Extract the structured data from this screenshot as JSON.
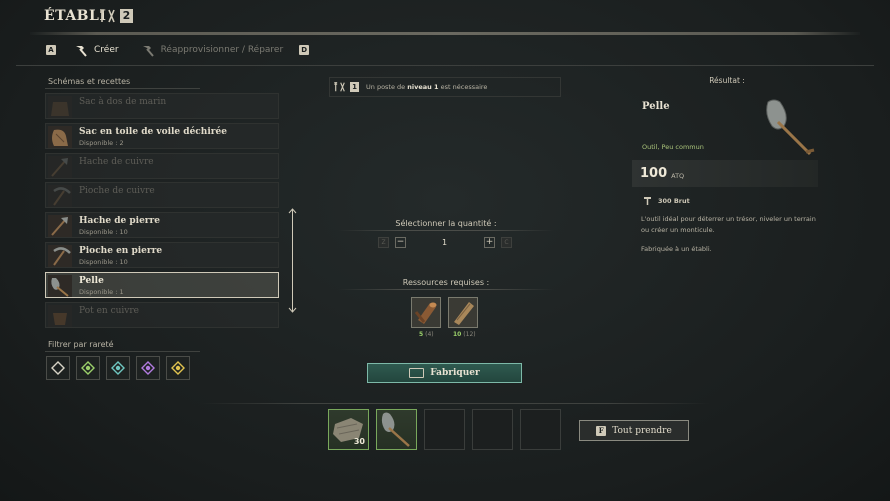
{
  "header": {
    "title": "ÉTABLI",
    "level": "2"
  },
  "tabs": {
    "left_key": "A",
    "right_key": "D",
    "items": [
      {
        "label": "Créer",
        "icon": "hammer-icon"
      },
      {
        "label": "Réapprovisionner / Réparer",
        "icon": "repair-hammer-icon"
      }
    ]
  },
  "recipes": {
    "title": "Schémas et recettes",
    "items": [
      {
        "name": "Sac à dos de marin",
        "available": "",
        "state": "disabled",
        "icon": "backpack-icon"
      },
      {
        "name": "Sac en toile de voile déchirée",
        "available": "Disponible : 2",
        "state": "enabled",
        "icon": "cloth-bag-icon"
      },
      {
        "name": "Hache de cuivre",
        "available": "",
        "state": "disabled",
        "icon": "axe-icon"
      },
      {
        "name": "Pioche de cuivre",
        "available": "",
        "state": "disabled",
        "icon": "pickaxe-icon"
      },
      {
        "name": "Hache de pierre",
        "available": "Disponible : 10",
        "state": "enabled",
        "icon": "axe-icon"
      },
      {
        "name": "Pioche en pierre",
        "available": "Disponible : 10",
        "state": "enabled",
        "icon": "pickaxe-icon"
      },
      {
        "name": "Pelle",
        "available": "Disponible : 1",
        "state": "selected",
        "icon": "shovel-icon"
      },
      {
        "name": "Pot en cuivre",
        "available": "",
        "state": "disabled",
        "icon": "pot-icon"
      }
    ]
  },
  "rarity_filter": {
    "title": "Filtrer par rareté",
    "colors": [
      "#d8d4c6",
      "#9bd06a",
      "#6fc6c0",
      "#b27be0",
      "#e1c34f"
    ]
  },
  "requirement": {
    "prefix": "Un poste de ",
    "bold": "niveau 1",
    "suffix": " est nécessaire",
    "level": "1"
  },
  "quantity": {
    "title": "Sélectionner la quantité :",
    "value": "1",
    "left_key": "Z",
    "right_key": "C"
  },
  "resources": {
    "title": "Ressources requises :",
    "items": [
      {
        "have": "5",
        "need": "(4)",
        "icon": "wood-log-icon"
      },
      {
        "have": "10",
        "need": "(12)",
        "icon": "plank-icon"
      }
    ]
  },
  "craft_button": {
    "label": "Fabriquer"
  },
  "result": {
    "header": "Résultat :",
    "name": "Pelle",
    "type": "Outil, Peu commun",
    "atq_value": "100",
    "atq_unit": "ATQ",
    "brut": "300 Brut",
    "description": "L'outil idéal pour déterrer un trésor, niveler un terrain ou créer un monticule.",
    "fabricated": "Fabriquée à un établi."
  },
  "output_slots": [
    {
      "filled": true,
      "icon": "cloth-icon",
      "count": "30"
    },
    {
      "filled": true,
      "icon": "shovel-icon",
      "count": ""
    },
    {
      "filled": false
    },
    {
      "filled": false
    },
    {
      "filled": false
    }
  ],
  "take_all": {
    "key": "F",
    "label": "Tout prendre"
  }
}
